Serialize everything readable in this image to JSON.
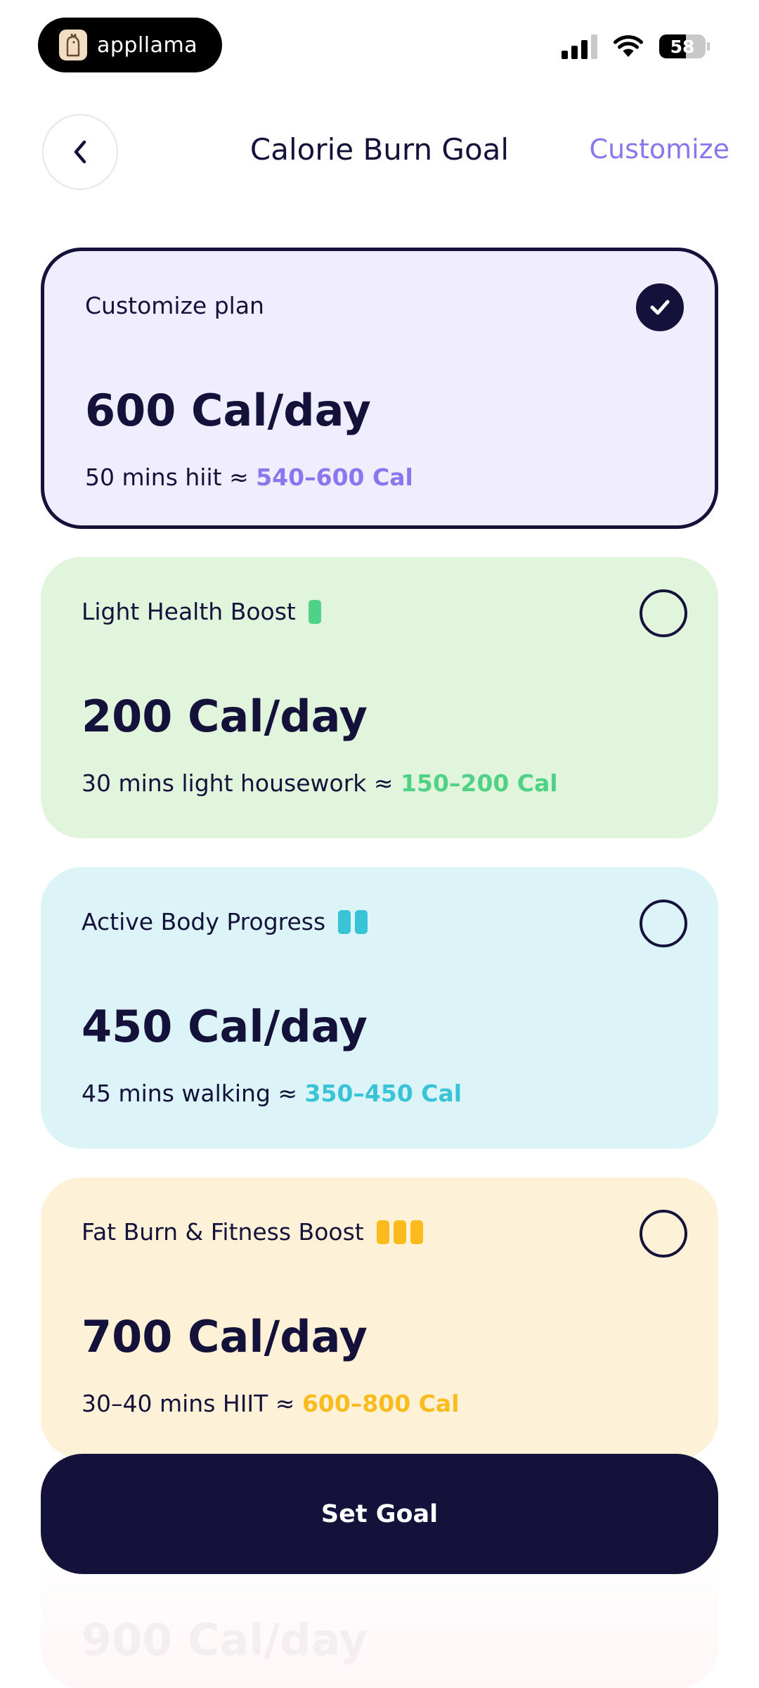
{
  "status_bar": {
    "brand_name": "appllama",
    "battery": "58",
    "battery_level": 58,
    "signal_bars_on": 3,
    "signal_bars_total": 4
  },
  "header": {
    "title": "Calorie Burn Goal",
    "customize_label": "Customize"
  },
  "cards": [
    {
      "title": "Customize plan",
      "kcal": "600 Cal/day",
      "desc": "50 mins hiit ≈ ",
      "range": "540–600 Cal",
      "bg": "#f0eefe",
      "accent": "#8c76f0",
      "intensity_bars": 0,
      "selected": true
    },
    {
      "title": "Light Health Boost",
      "kcal": "200 Cal/day",
      "desc": "30 mins light housework ≈ ",
      "range": "150–200 Cal",
      "bg": "#e1f4dc",
      "accent": "#4fd285",
      "intensity_bars": 1,
      "selected": false
    },
    {
      "title": "Active Body Progress",
      "kcal": "450 Cal/day",
      "desc": "45 mins walking ≈ ",
      "range": "350–450 Cal",
      "bg": "#dcf4f7",
      "accent": "#38c4d6",
      "intensity_bars": 2,
      "selected": false
    },
    {
      "title": "Fat Burn & Fitness Boost",
      "kcal": "700 Cal/day",
      "desc": "30–40 mins HIIT ≈ ",
      "range": "600–800 Cal",
      "bg": "#fdf2d8",
      "accent": "#fbbb1c",
      "intensity_bars": 3,
      "selected": false
    }
  ],
  "footer": {
    "set_goal_label": "Set Goal",
    "partial_kcal": "900 Cal/day"
  },
  "colors": {
    "primary": "#14123a",
    "accent": "#8c76f0"
  }
}
